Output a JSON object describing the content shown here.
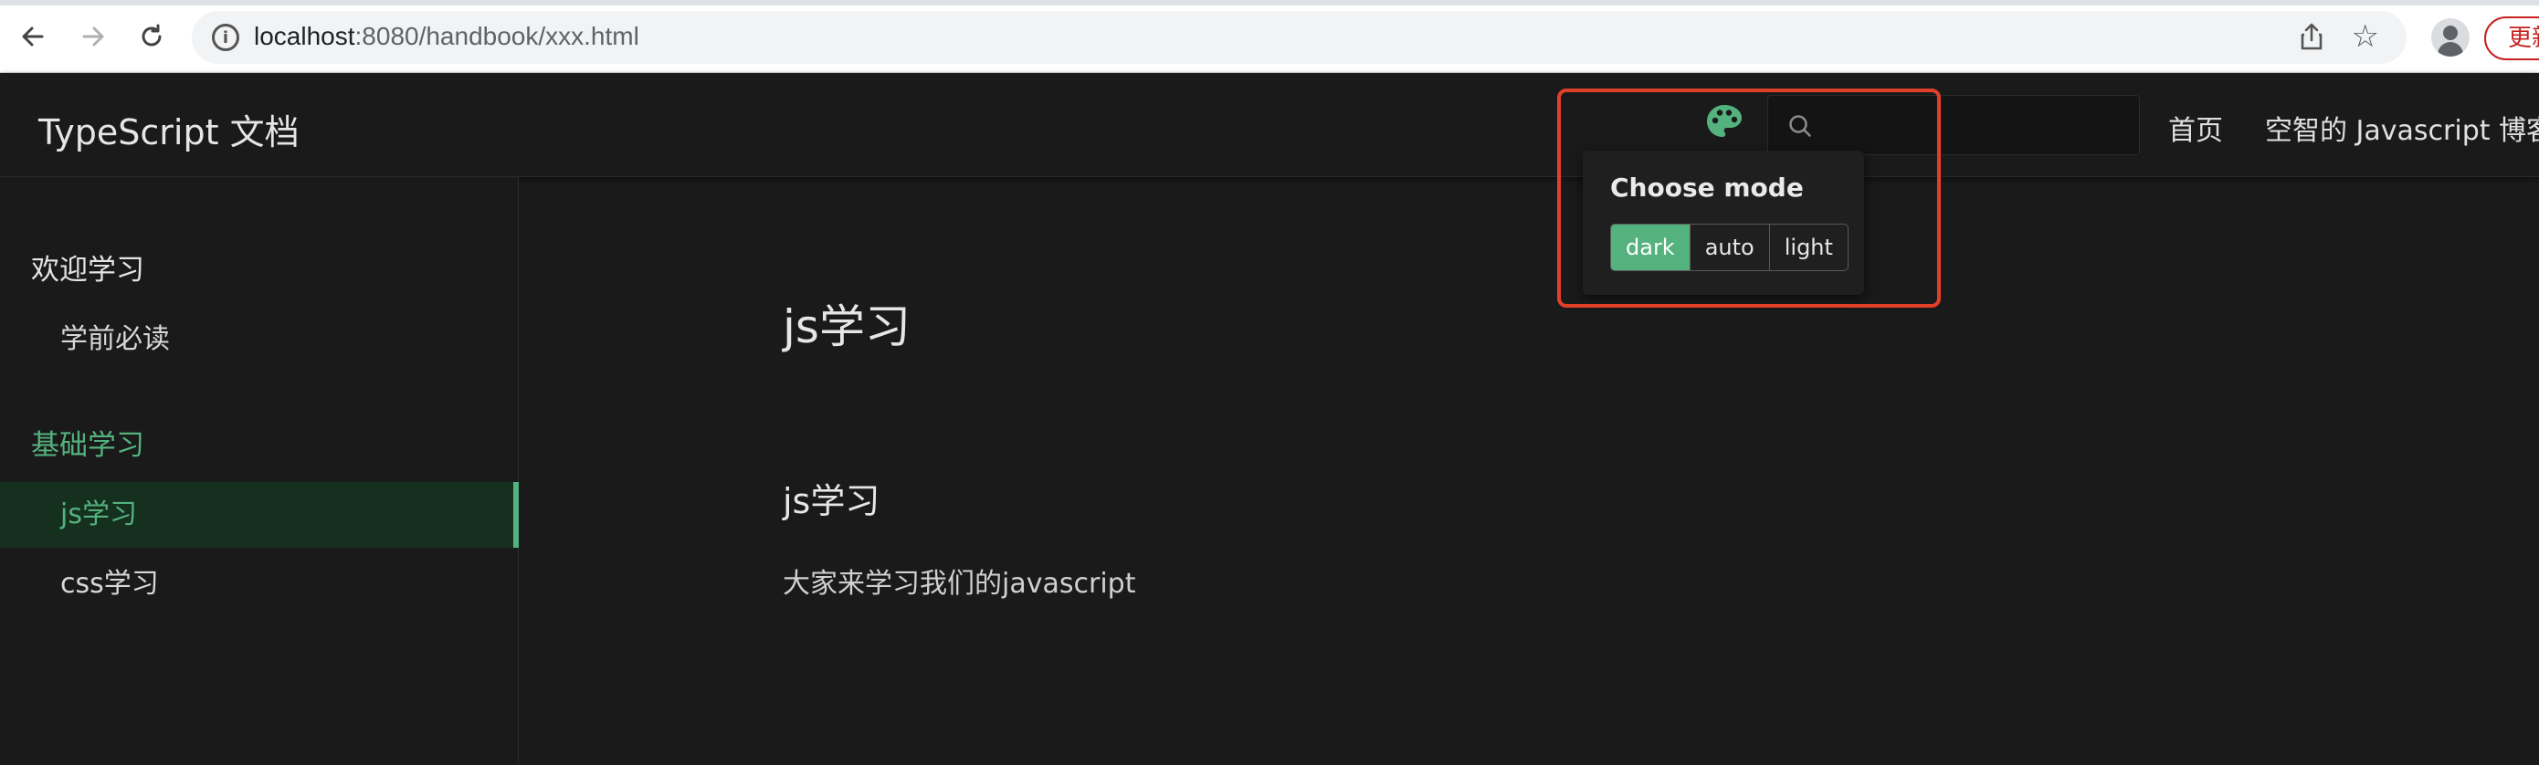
{
  "browser": {
    "url_host": "localhost",
    "url_rest": ":8080/handbook/xxx.html",
    "update_label": "更新"
  },
  "header": {
    "title": "TypeScript 文档",
    "nav": [
      "首页",
      "空智的 Javascript 博客"
    ]
  },
  "mode_popup": {
    "title": "Choose mode",
    "options": [
      "dark",
      "auto",
      "light"
    ],
    "selected": "dark"
  },
  "sidebar": {
    "groups": [
      {
        "label": "欢迎学习",
        "items": [
          "学前必读"
        ]
      },
      {
        "label": "基础学习",
        "items": [
          "js学习",
          "css学习"
        ]
      }
    ],
    "active_item": "js学习"
  },
  "content": {
    "h1": "js学习",
    "h2": "js学习",
    "paragraph": "大家来学习我们的javascript"
  },
  "colors": {
    "accent": "#54b27e",
    "background": "#1a1a1a",
    "highlight": "#e0402a"
  }
}
